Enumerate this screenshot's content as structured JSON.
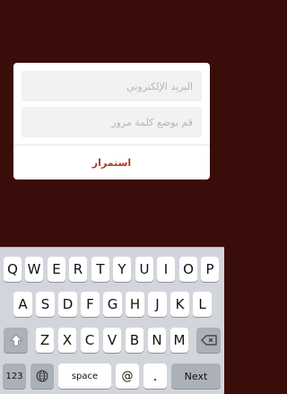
{
  "login": {
    "email_placeholder": "البريد الإلكتروني",
    "password_placeholder": "قم بوضع كلمة مرور",
    "continue_label": "استمرار"
  },
  "keyboard": {
    "row1": [
      "Q",
      "W",
      "E",
      "R",
      "T",
      "Y",
      "U",
      "I",
      "O",
      "P"
    ],
    "row2": [
      "A",
      "S",
      "D",
      "F",
      "G",
      "H",
      "J",
      "K",
      "L"
    ],
    "row3": [
      "Z",
      "X",
      "C",
      "V",
      "B",
      "N",
      "M"
    ],
    "numbers_label": "123",
    "space_label": "space",
    "at_label": "@",
    "dot_label": ".",
    "next_label": "Next",
    "globe_icon": "globe-icon",
    "shift_icon": "shift-icon",
    "backspace_icon": "backspace-icon"
  },
  "colors": {
    "background": "#3a0d0b",
    "accent": "#b23a2a"
  }
}
